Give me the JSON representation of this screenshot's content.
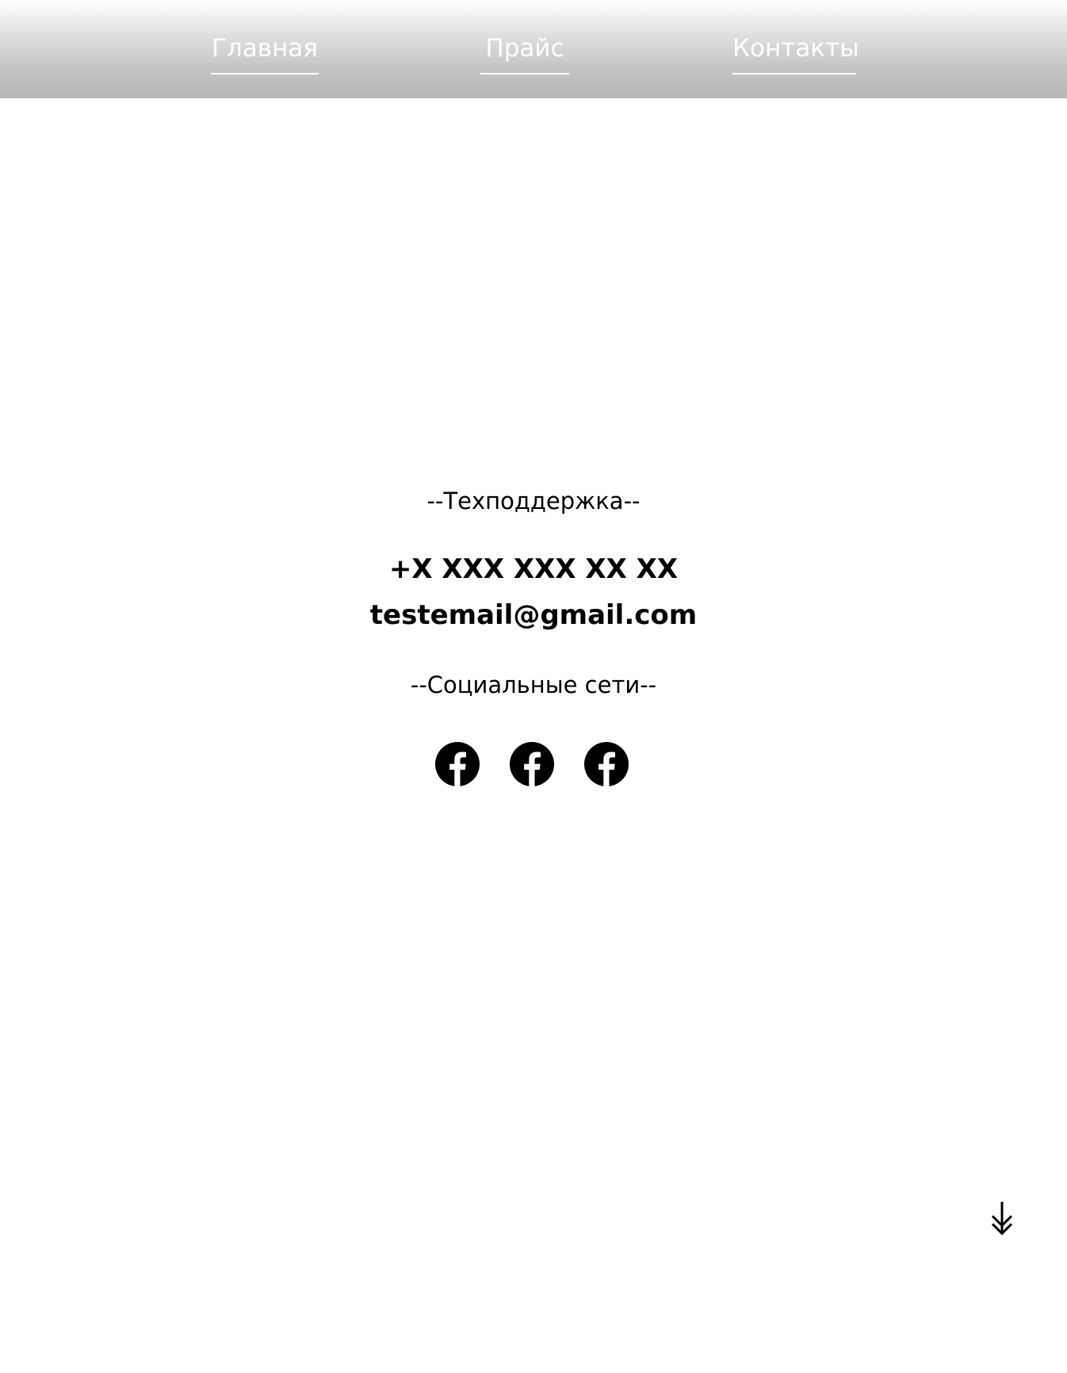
{
  "nav": {
    "items": [
      {
        "label": "Главная"
      },
      {
        "label": "Прайс"
      },
      {
        "label": "Контакты"
      }
    ]
  },
  "support": {
    "heading": "--Техподдержка--",
    "phone": "+X XXX XXX XX XX",
    "email": "testemail@gmail.com"
  },
  "social": {
    "heading": "--Социальные сети--",
    "links": [
      {
        "icon": "facebook-icon"
      },
      {
        "icon": "facebook-icon"
      },
      {
        "icon": "facebook-icon"
      }
    ]
  },
  "scroll": {
    "icon": "arrow-down-icon"
  },
  "colors": {
    "nav_text": "#ffffff",
    "header_gradient_top": "#ffffff",
    "header_gradient_bottom": "#b5b5b5",
    "text": "#000000"
  }
}
